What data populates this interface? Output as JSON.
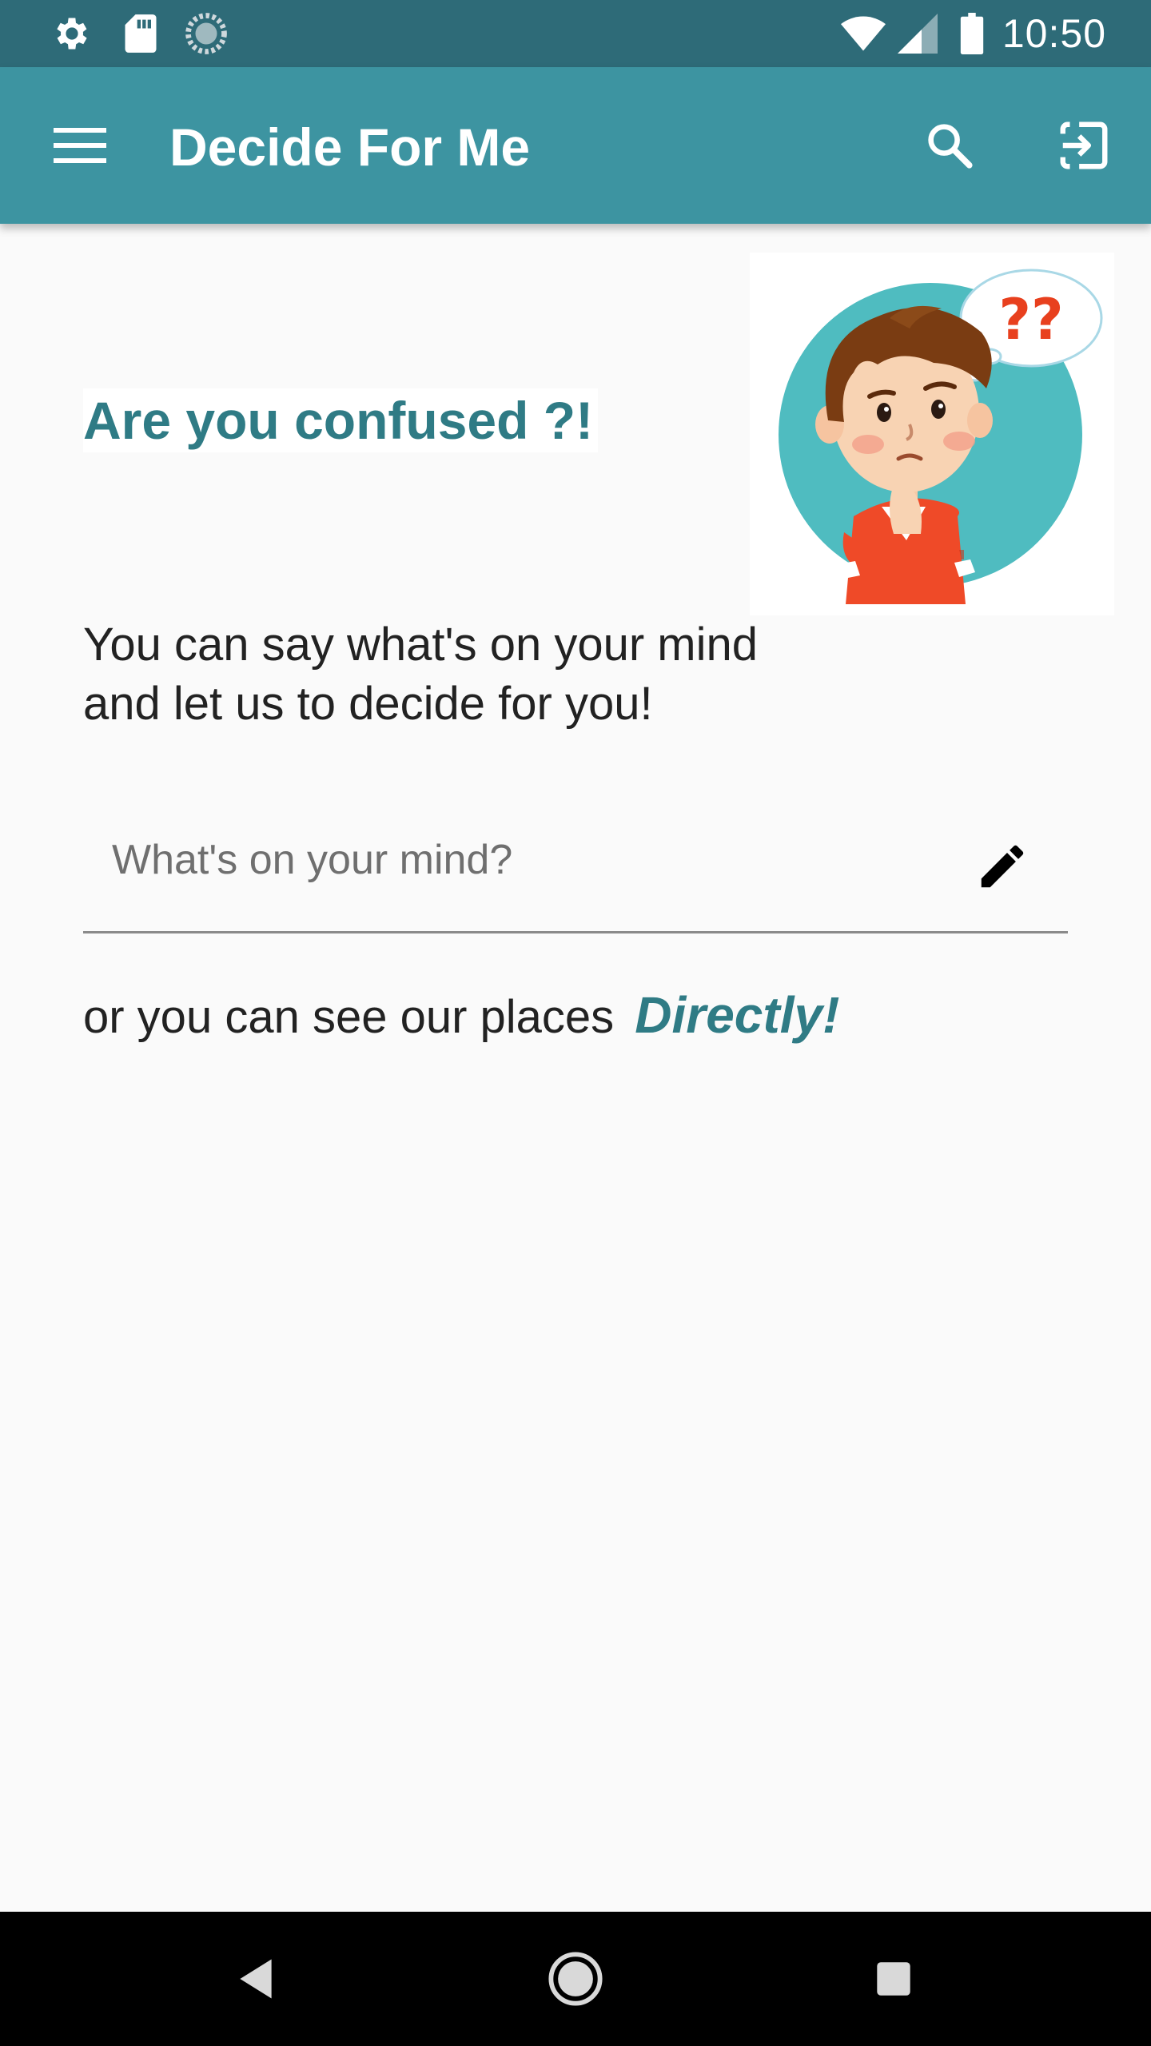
{
  "status_bar": {
    "time": "10:50",
    "left_icons": [
      "settings-icon",
      "sd-card-icon",
      "sync-icon"
    ],
    "right_icons": [
      "wifi-icon",
      "cell-signal-icon",
      "battery-icon"
    ]
  },
  "app_bar": {
    "title": "Decide For Me",
    "menu_icon": "hamburger-menu-icon",
    "search_icon": "search-icon",
    "logout_icon": "logout-icon"
  },
  "main": {
    "headline": "Are you confused ?!",
    "intro_line1": "You can say what's on your mind",
    "intro_line2": "and let us to decide for you!",
    "mind_input": {
      "value": "",
      "placeholder": "What's on your mind?"
    },
    "places_text": "or you can see our places",
    "directly_label": "Directly!",
    "bubble_text": "??"
  },
  "colors": {
    "status_bar": "#2e6b78",
    "app_bar": "#3d94a1",
    "accent_text": "#2f7b85",
    "background": "#fafafa"
  },
  "nav_bar": {
    "icons": [
      "back-icon",
      "home-icon",
      "recents-icon"
    ]
  }
}
